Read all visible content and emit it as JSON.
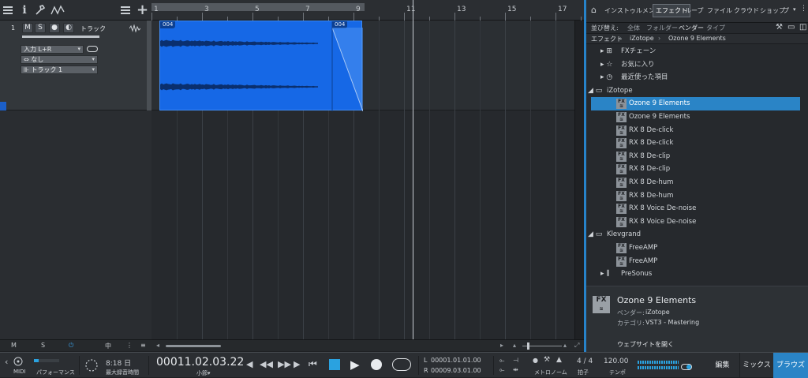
{
  "toolbar": {
    "icons": [
      "menu-icon",
      "info-icon",
      "tool-wrench-icon",
      "automation-curve-icon",
      "list-icon",
      "add-icon"
    ]
  },
  "track": {
    "number": "1",
    "mute": "M",
    "solo": "S",
    "name": "トラック",
    "input": "入力 L+R",
    "output": "なし",
    "channel": "トラック 1"
  },
  "ruler": {
    "bars": [
      "1",
      "3",
      "5",
      "7",
      "9",
      "11",
      "13",
      "15",
      "17"
    ]
  },
  "clip": {
    "tag_left": "004",
    "tag_right": "004"
  },
  "left_footer": {
    "m": "M",
    "s": "S",
    "size": "中"
  },
  "browser": {
    "tabs": [
      "インストゥルメント",
      "エフェクト",
      "ループ",
      "ファイル",
      "クラウド",
      "ショップ",
      "プ"
    ],
    "active_tab": "エフェクト",
    "sort_label": "並び替え:",
    "sort_options": [
      "全体",
      "フォルダー",
      "ベンダー",
      "タイプ"
    ],
    "sort_active": "ベンダー",
    "breadcrumb": [
      "エフェクト",
      "iZotope",
      "Ozone 9 Elements"
    ],
    "items": [
      {
        "label": "FXチェーン",
        "kind": "chain"
      },
      {
        "label": "お気に入り",
        "kind": "star"
      },
      {
        "label": "最近使った項目",
        "kind": "clock"
      },
      {
        "label": "iZotope",
        "kind": "folder"
      },
      {
        "label": "Ozone 9 Elements",
        "kind": "fx",
        "selected": true
      },
      {
        "label": "Ozone 9 Elements",
        "kind": "fx"
      },
      {
        "label": "RX 8 De-click",
        "kind": "fx"
      },
      {
        "label": "RX 8 De-click",
        "kind": "fx"
      },
      {
        "label": "RX 8 De-clip",
        "kind": "fx"
      },
      {
        "label": "RX 8 De-clip",
        "kind": "fx"
      },
      {
        "label": "RX 8 De-hum",
        "kind": "fx"
      },
      {
        "label": "RX 8 De-hum",
        "kind": "fx"
      },
      {
        "label": "RX 8 Voice De-noise",
        "kind": "fx"
      },
      {
        "label": "RX 8 Voice De-noise",
        "kind": "fx"
      },
      {
        "label": "Klevgrand",
        "kind": "folder"
      },
      {
        "label": "FreeAMP",
        "kind": "fx"
      },
      {
        "label": "FreeAMP",
        "kind": "fx"
      },
      {
        "label": "PreSonus",
        "kind": "vendor"
      }
    ],
    "detail": {
      "title": "Ozone 9 Elements",
      "vendor_label": "ベンダー:",
      "vendor": "iZotope",
      "category_label": "カテゴリ:",
      "category": "VST3 - Mastering",
      "website_link": "ウェブサイトを開く"
    }
  },
  "transport": {
    "midi_label": "MIDI",
    "performance_label": "パフォーマンス",
    "rec_time": "8:18 日",
    "rec_time_label": "最大録音時間",
    "position": "00011.02.03.22",
    "position_unit": "小節▾",
    "loop_l": "00001.01.01.00",
    "loop_r": "00009.03.01.00",
    "l_label": "L",
    "r_label": "R",
    "metronome_label": "メトロノーム",
    "time_sig": "4 / 4",
    "time_sig_label": "拍子",
    "tempo": "120.00",
    "tempo_label": "テンポ",
    "edit_btn": "編集",
    "mix_btn": "ミックス",
    "browse_btn": "ブラウズ"
  },
  "colors": {
    "clip": "#1668e6",
    "selection": "#2a84c6",
    "transport_stop": "#2aa2e0",
    "browse_active": "#2a84c6"
  }
}
